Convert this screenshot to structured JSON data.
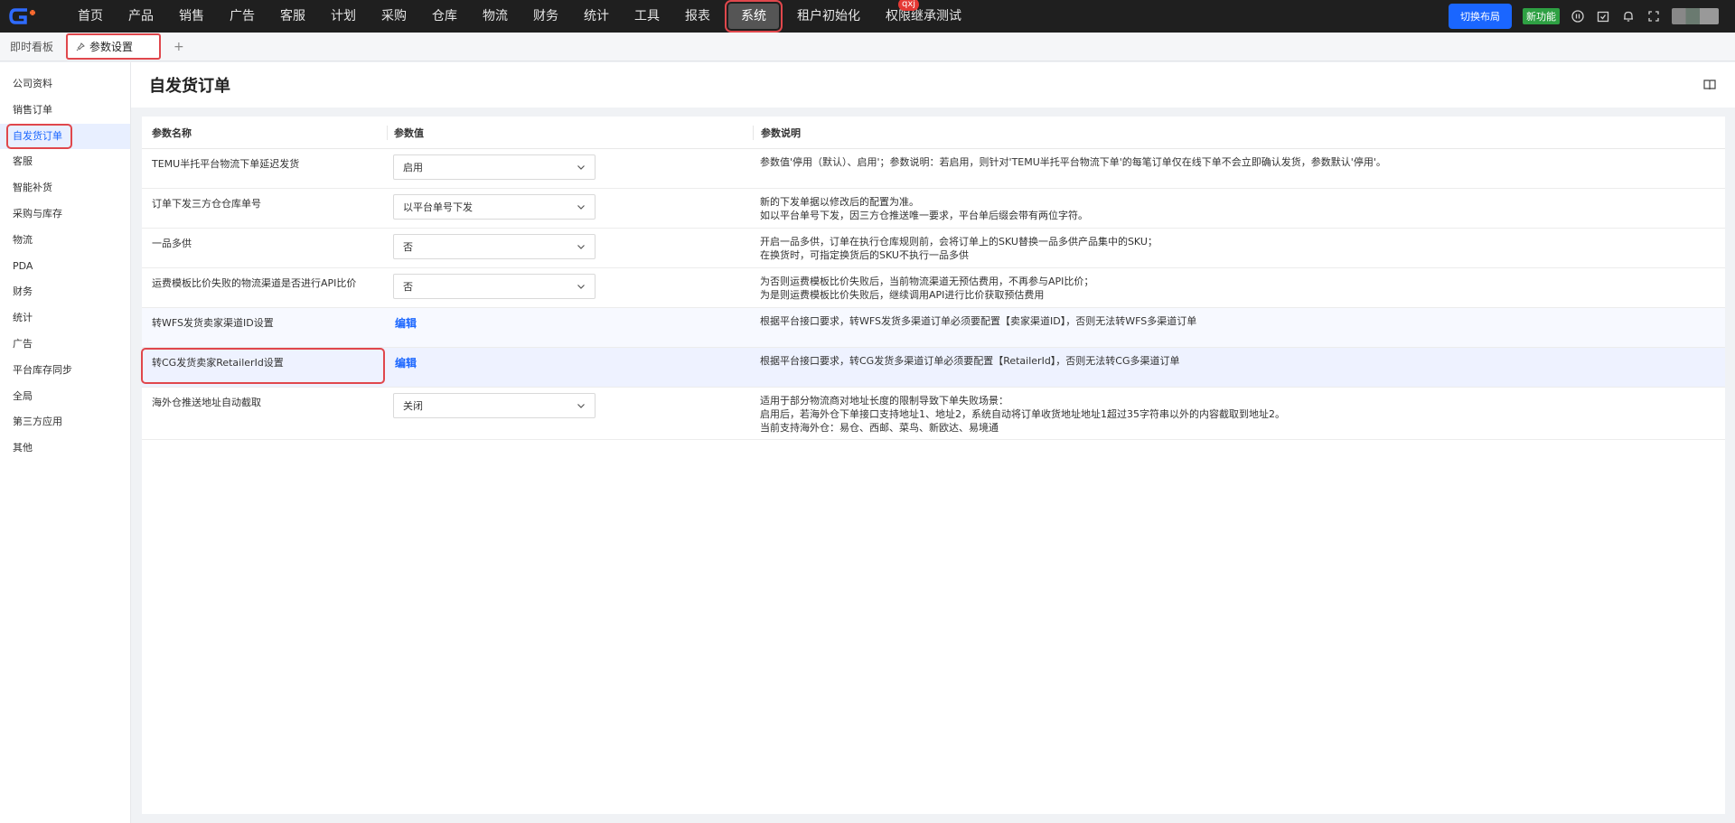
{
  "nav": {
    "items": [
      "首页",
      "产品",
      "销售",
      "广告",
      "客服",
      "计划",
      "采购",
      "仓库",
      "物流",
      "财务",
      "统计",
      "工具",
      "报表",
      "系统",
      "租户初始化",
      "权限继承测试"
    ],
    "active_index": 13,
    "badge": "qxj",
    "switch_layout": "切换布局",
    "new_feature": "新功能"
  },
  "tabs": {
    "dashboard": "即时看板",
    "active": "参数设置",
    "add": "+"
  },
  "sidebar": {
    "items": [
      "公司资料",
      "销售订单",
      "自发货订单",
      "客服",
      "智能补货",
      "采购与库存",
      "物流",
      "PDA",
      "财务",
      "统计",
      "广告",
      "平台库存同步",
      "全局",
      "第三方应用",
      "其他"
    ],
    "active_index": 2
  },
  "page": {
    "title": "自发货订单"
  },
  "table": {
    "headers": [
      "参数名称",
      "参数值",
      "参数说明"
    ],
    "rows": [
      {
        "name": "TEMU半托平台物流下单延迟发货",
        "type": "select",
        "value": "启用",
        "desc": [
          "参数值'停用（默认）、启用'；参数说明：若启用，则针对'TEMU半托平台物流下单'的每笔订单仅在线下单不会立即确认发货，参数默认'停用'。"
        ]
      },
      {
        "name": "订单下发三方仓仓库单号",
        "type": "select",
        "value": "以平台单号下发",
        "desc": [
          "新的下发单据以修改后的配置为准。",
          "如以平台单号下发，因三方仓推送唯一要求，平台单后缀会带有两位字符。"
        ]
      },
      {
        "name": "一品多供",
        "type": "select",
        "value": "否",
        "desc": [
          "开启一品多供，订单在执行仓库规则前，会将订单上的SKU替换一品多供产品集中的SKU；",
          "在换货时，可指定换货后的SKU不执行一品多供"
        ]
      },
      {
        "name": "运费模板比价失败的物流渠道是否进行API比价",
        "type": "select",
        "value": "否",
        "desc": [
          "为否则运费模板比价失败后，当前物流渠道无预估费用，不再参与API比价；",
          "为是则运费模板比价失败后，继续调用API进行比价获取预估费用"
        ]
      },
      {
        "name": "转WFS发货卖家渠道ID设置",
        "type": "link",
        "value": "编辑",
        "desc": [
          "根据平台接口要求，转WFS发货多渠道订单必须要配置【卖家渠道ID】，否则无法转WFS多渠道订单"
        ]
      },
      {
        "name": "转CG发货卖家RetailerId设置",
        "type": "link",
        "value": "编辑",
        "desc": [
          "根据平台接口要求，转CG发货多渠道订单必须要配置【RetailerId】，否则无法转CG多渠道订单"
        ]
      },
      {
        "name": "海外仓推送地址自动截取",
        "type": "select",
        "value": "关闭",
        "desc": [
          "适用于部分物流商对地址长度的限制导致下单失败场景：",
          "启用后，若海外仓下单接口支持地址1、地址2，系统自动将订单收货地址地址1超过35字符串以外的内容截取到地址2。",
          "当前支持海外仓：易仓、西邮、菜鸟、新欧达、易境通"
        ]
      }
    ]
  }
}
